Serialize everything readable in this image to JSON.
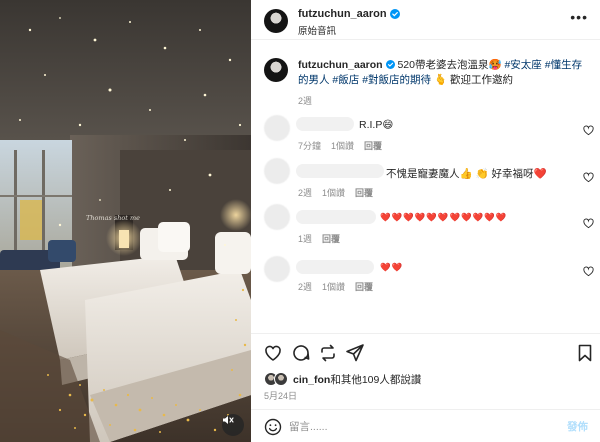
{
  "post": {
    "username": "futzuchun_aaron",
    "audio_label": "原始音訊",
    "more_icon": "more-horizontal-icon"
  },
  "photo": {
    "overlay_text": "Thomas shot me",
    "mute_icon": "volume-muted-icon"
  },
  "caption": {
    "username": "futzuchun_aaron",
    "text_before": "520帶老婆去泡溫泉",
    "emoji1": "🥵",
    "tags": [
      "#安太座",
      "#懂生存的男人",
      "#飯店",
      "#對飯店的期待"
    ],
    "text_after": "歡迎工作邀約",
    "emoji2": "🫰",
    "time": "2週"
  },
  "comments": [
    {
      "text": "R.I.P😄",
      "time": "7分鐘",
      "likes": "1個讚",
      "reply": "回覆"
    },
    {
      "text": "不愧是寵妻魔人👍 👏 好幸福呀❤️",
      "time": "2週",
      "likes": "1個讚",
      "reply": "回覆"
    },
    {
      "text": "❤️❤️❤️❤️❤️❤️❤️❤️❤️❤️❤️",
      "time": "1週",
      "likes": "",
      "reply": "回覆"
    },
    {
      "text": "❤️❤️",
      "time": "2週",
      "likes": "1個讚",
      "reply": "回覆"
    }
  ],
  "actions": {
    "like_icon": "heart-icon",
    "comment_icon": "comment-icon",
    "repost_icon": "repost-icon",
    "share_icon": "send-icon",
    "save_icon": "bookmark-icon"
  },
  "likes": {
    "liker": "cin_fon",
    "text": "和其他109人都說讚"
  },
  "date": "5月24日",
  "comment_box": {
    "placeholder": "留言......",
    "post_label": "發佈"
  },
  "colors": {
    "tag": "#00376b",
    "verified": "#0095f6",
    "heart_red": "#e8344a",
    "post_button": "#b2dffc"
  }
}
